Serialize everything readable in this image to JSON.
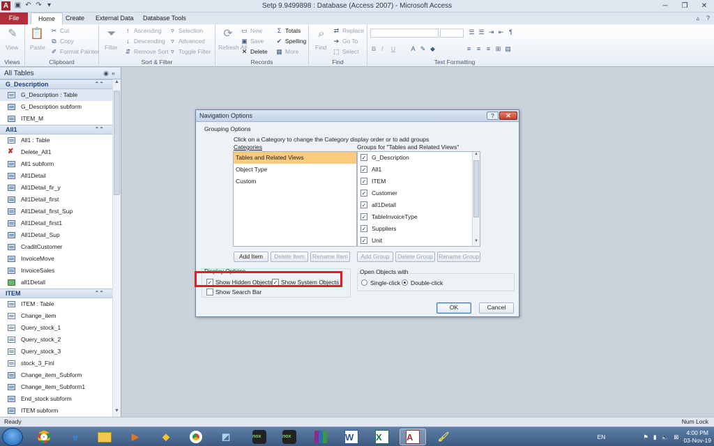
{
  "window": {
    "app_icon": "A",
    "title": "Setp 9.9499898 : Database (Access 2007)  -  Microsoft Access",
    "controls": [
      "─",
      "❐",
      "✕"
    ]
  },
  "quick_access": [
    "save-icon",
    "undo-icon",
    "redo-icon",
    "customize-icon"
  ],
  "ribbon_tabs": [
    {
      "label": "File",
      "active": false
    },
    {
      "label": "Home",
      "active": true
    },
    {
      "label": "Create",
      "active": false
    },
    {
      "label": "External Data",
      "active": false
    },
    {
      "label": "Database Tools",
      "active": false
    }
  ],
  "ribbon": {
    "views": {
      "label": "View",
      "group": "Views"
    },
    "clipboard": {
      "paste": "Paste",
      "cut": "Cut",
      "copy": "Copy",
      "format_painter": "Format Painter",
      "group": "Clipboard"
    },
    "sort_filter": {
      "filter": "Filter",
      "ascending": "Ascending",
      "descending": "Descending",
      "remove_sort": "Remove Sort",
      "selection": "Selection",
      "advanced": "Advanced",
      "toggle_filter": "Toggle Filter",
      "group": "Sort & Filter"
    },
    "records": {
      "refresh": "Refresh All",
      "new": "New",
      "save": "Save",
      "delete": "Delete",
      "totals": "Totals",
      "spelling": "Spelling",
      "more": "More",
      "group": "Records"
    },
    "find": {
      "find": "Find",
      "replace": "Replace",
      "goto": "Go To",
      "select": "Select",
      "group": "Find"
    },
    "text_formatting": {
      "bold": "B",
      "italic": "I",
      "underline": "U",
      "group": "Text Formatting"
    }
  },
  "nav_pane": {
    "title": "All Tables",
    "groups": [
      {
        "name": "G_Description",
        "items": [
          {
            "label": "G_Description : Table",
            "type": "table",
            "selected": true
          },
          {
            "label": "G_Description subform",
            "type": "form"
          },
          {
            "label": "ITEM_M",
            "type": "form"
          }
        ]
      },
      {
        "name": "All1",
        "items": [
          {
            "label": "All1 : Table",
            "type": "table"
          },
          {
            "label": "Delete_All1",
            "type": "delete"
          },
          {
            "label": "All1 subform",
            "type": "form"
          },
          {
            "label": "All1Detail",
            "type": "form"
          },
          {
            "label": "All1Detail_fir_y",
            "type": "form"
          },
          {
            "label": "All1Detail_first",
            "type": "form"
          },
          {
            "label": "All1Detail_first_Sup",
            "type": "form"
          },
          {
            "label": "All1Detail_first1",
            "type": "form"
          },
          {
            "label": "All1Detail_Sup",
            "type": "form"
          },
          {
            "label": "CraditCustomer",
            "type": "form"
          },
          {
            "label": "InvoiceMove",
            "type": "form"
          },
          {
            "label": "InvoiceSales",
            "type": "form"
          },
          {
            "label": "all1Detall",
            "type": "report"
          }
        ]
      },
      {
        "name": "ITEM",
        "items": [
          {
            "label": "ITEM : Table",
            "type": "table"
          },
          {
            "label": "Change_item",
            "type": "query"
          },
          {
            "label": "Query_stock_1",
            "type": "query"
          },
          {
            "label": "Query_stock_2",
            "type": "query"
          },
          {
            "label": "Query_stock_3",
            "type": "query"
          },
          {
            "label": "stock_3_Finl",
            "type": "query"
          },
          {
            "label": "Change_item_Subform",
            "type": "form"
          },
          {
            "label": "Change_item_Subform1",
            "type": "form"
          },
          {
            "label": "End_stock subform",
            "type": "form"
          },
          {
            "label": "ITEM subform",
            "type": "form"
          }
        ]
      }
    ]
  },
  "dialog": {
    "title": "Navigation Options",
    "grouping_options_label": "Grouping Options",
    "instructions": "Click on a Category to change the Category display order or to add groups",
    "categories_label": "Categories",
    "groups_label": "Groups for \"Tables and Related Views\"",
    "categories": [
      {
        "label": "Tables and Related Views",
        "selected": true
      },
      {
        "label": "Object Type",
        "selected": false
      },
      {
        "label": "Custom",
        "selected": false
      }
    ],
    "groups": [
      {
        "label": "G_Description",
        "checked": true
      },
      {
        "label": "All1",
        "checked": true
      },
      {
        "label": "ITEM",
        "checked": true
      },
      {
        "label": "Customer",
        "checked": true
      },
      {
        "label": "all1Detall",
        "checked": true
      },
      {
        "label": "TableInvoiceType",
        "checked": true
      },
      {
        "label": "Suppliers",
        "checked": true
      },
      {
        "label": "Unit",
        "checked": true
      }
    ],
    "buttons": {
      "add_item": "Add Item",
      "delete_item": "Delete Item",
      "rename_item": "Rename Item",
      "add_group": "Add Group",
      "delete_group": "Delete Group",
      "rename_group": "Rename Group",
      "ok": "OK",
      "cancel": "Cancel"
    },
    "display_options_label": "Display Options",
    "show_hidden": {
      "label": "Show Hidden Objects",
      "checked": true
    },
    "show_system": {
      "label": "Show System Objects",
      "checked": true
    },
    "show_search_bar": {
      "label": "Show Search Bar",
      "checked": false
    },
    "open_objects_label": "Open Objects with",
    "single_click": {
      "label": "Single-click",
      "selected": false
    },
    "double_click": {
      "label": "Double-click",
      "selected": true
    }
  },
  "status_bar": {
    "left": "Ready",
    "right": "Num Lock"
  },
  "taskbar": {
    "apps": [
      "chrome-icon",
      "ie-icon",
      "explorer-icon",
      "media-icon",
      "app-icon",
      "chrome-icon",
      "app-icon",
      "nox-icon",
      "nox-icon",
      "winrar-icon",
      "word-icon",
      "excel-icon",
      "access-icon",
      "paint-icon"
    ],
    "language": "EN",
    "time": "4:00 PM",
    "date": "03-Nov-19"
  },
  "colors": {
    "accent": "#b52d3a",
    "highlight": "#e01c24",
    "selection": "#f9cb7c"
  }
}
